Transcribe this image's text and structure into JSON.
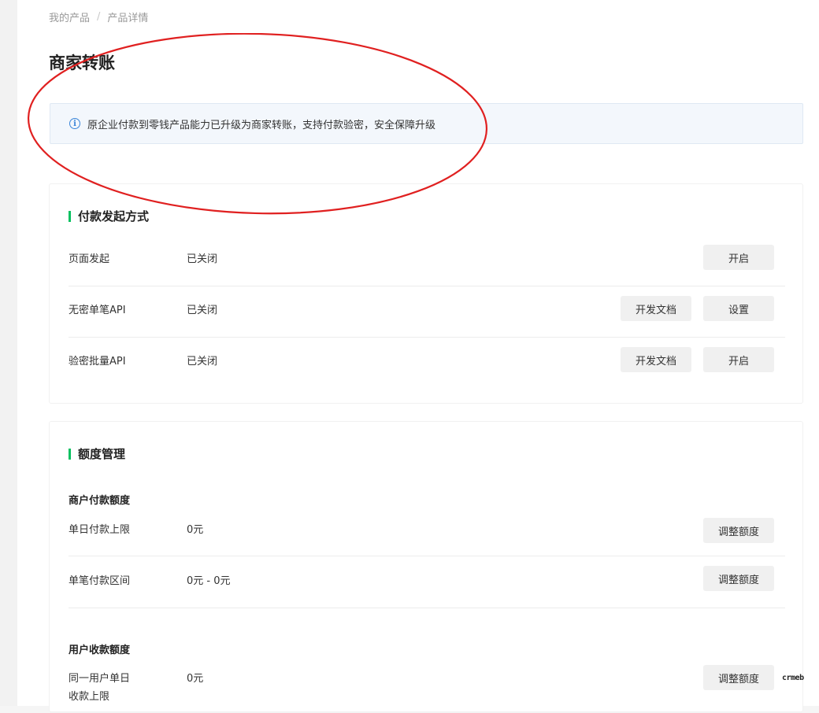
{
  "breadcrumb": {
    "items": [
      "我的产品",
      "产品详情"
    ],
    "separator": "/"
  },
  "page_title": "商家转账",
  "notice": {
    "icon": "info-circle-icon",
    "text": "原企业付款到零钱产品能力已升级为商家转账，支持付款验密，安全保障升级"
  },
  "payment_methods": {
    "title": "付款发起方式",
    "rows": [
      {
        "label": "页面发起",
        "status": "已关闭",
        "buttons": [
          "开启"
        ]
      },
      {
        "label": "无密单笔API",
        "status": "已关闭",
        "buttons": [
          "开发文档",
          "设置"
        ]
      },
      {
        "label": "验密批量API",
        "status": "已关闭",
        "buttons": [
          "开发文档",
          "开启"
        ]
      }
    ]
  },
  "quota": {
    "title": "额度管理",
    "merchant": {
      "heading": "商户付款额度",
      "rows": [
        {
          "label": "单日付款上限",
          "value": "0元",
          "button": "调整额度"
        },
        {
          "label": "单笔付款区间",
          "value": "0元 - 0元",
          "button": "调整额度"
        }
      ]
    },
    "user": {
      "heading": "用户收款额度",
      "rows": [
        {
          "label_line1": "同一用户单日",
          "label_line2": "收款上限",
          "value": "0元",
          "button": "调整额度"
        }
      ]
    }
  },
  "watermark": "crmeb",
  "colors": {
    "accent": "#07c160",
    "info": "#3a85d8",
    "annotation": "#e02020"
  }
}
